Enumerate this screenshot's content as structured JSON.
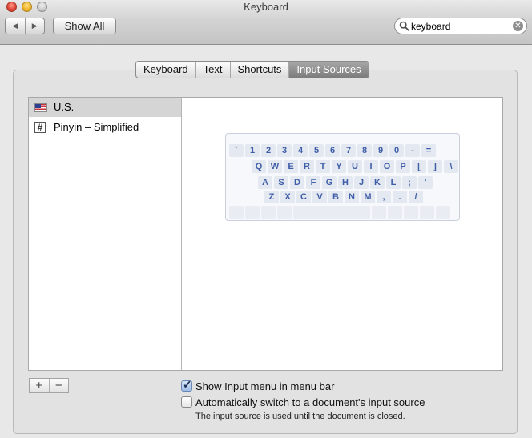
{
  "window": {
    "title": "Keyboard"
  },
  "toolbar": {
    "back_icon": "◀",
    "forward_icon": "▶",
    "show_all_label": "Show All"
  },
  "search": {
    "value": "keyboard",
    "clear_icon": "✕"
  },
  "tabs": [
    {
      "label": "Keyboard",
      "active": false
    },
    {
      "label": "Text",
      "active": false
    },
    {
      "label": "Shortcuts",
      "active": false
    },
    {
      "label": "Input Sources",
      "active": true
    }
  ],
  "input_sources": [
    {
      "label": "U.S.",
      "icon": "us-flag-icon",
      "selected": true
    },
    {
      "label": "Pinyin – Simplified",
      "icon": "pinyin-grid-icon",
      "selected": false
    }
  ],
  "keyboard_preview": {
    "rows": [
      [
        "`",
        "1",
        "2",
        "3",
        "4",
        "5",
        "6",
        "7",
        "8",
        "9",
        "0",
        "-",
        "="
      ],
      [
        "Q",
        "W",
        "E",
        "R",
        "T",
        "Y",
        "U",
        "I",
        "O",
        "P",
        "[",
        "]",
        "\\"
      ],
      [
        "A",
        "S",
        "D",
        "F",
        "G",
        "H",
        "J",
        "K",
        "L",
        ";",
        "'"
      ],
      [
        "Z",
        "X",
        "C",
        "V",
        "B",
        "N",
        "M",
        ",",
        ".",
        "/"
      ]
    ]
  },
  "list_controls": {
    "add_label": "+",
    "remove_label": "−"
  },
  "options": {
    "show_input_menu": {
      "label": "Show Input menu in menu bar",
      "checked": true,
      "check_glyph": "✓"
    },
    "auto_switch": {
      "label": "Automatically switch to a document's input source",
      "checked": false
    },
    "note": "The input source is used until the document is closed."
  },
  "colors": {
    "key_text": "#3e5ea8",
    "tab_active": "#8a8a8a",
    "selection": "#d5d5d5"
  }
}
